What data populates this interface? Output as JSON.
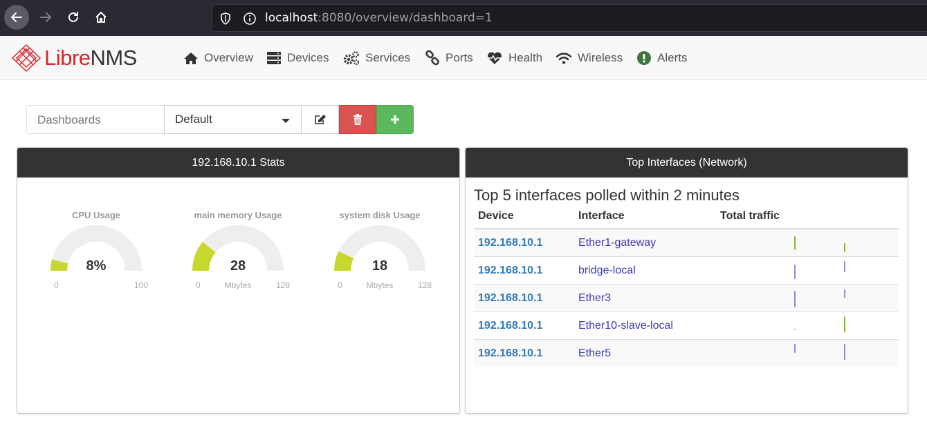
{
  "browser": {
    "url_host": "localhost",
    "url_rest": ":8080/overview/dashboard=1"
  },
  "brand": {
    "name_part1": "Libre",
    "name_part2": "NMS",
    "accent_color": "#d9262c"
  },
  "menu": [
    {
      "label": "Overview",
      "icon": "home-icon"
    },
    {
      "label": "Devices",
      "icon": "server-icon"
    },
    {
      "label": "Services",
      "icon": "cogs-icon"
    },
    {
      "label": "Ports",
      "icon": "link-icon"
    },
    {
      "label": "Health",
      "icon": "heartbeat-icon"
    },
    {
      "label": "Wireless",
      "icon": "wifi-icon"
    },
    {
      "label": "Alerts",
      "icon": "exclamation-circle-icon"
    }
  ],
  "dashboard": {
    "label": "Dashboards",
    "selected": "Default"
  },
  "stats_widget": {
    "title": "192.168.10.1 Stats",
    "gauges": [
      {
        "title": "CPU Usage",
        "value": 8,
        "display": "8%",
        "unit": "",
        "min": "0",
        "max": "100"
      },
      {
        "title": "main memory Usage",
        "value": 28,
        "display": "28",
        "unit": "Mbytes",
        "min": "0",
        "max": "128"
      },
      {
        "title": "system disk Usage",
        "value": 18,
        "display": "18",
        "unit": "Mbytes",
        "min": "0",
        "max": "128"
      }
    ],
    "gauge_fill_color": "#c8d72d",
    "gauge_track_color": "#eeeeee"
  },
  "interfaces_widget": {
    "title": "Top Interfaces (Network)",
    "subtitle": "Top 5 interfaces polled within 2 minutes",
    "columns": [
      "Device",
      "Interface",
      "Total traffic"
    ],
    "rows": [
      {
        "device": "192.168.10.1",
        "interface": "Ether1-gateway"
      },
      {
        "device": "192.168.10.1",
        "interface": "bridge-local"
      },
      {
        "device": "192.168.10.1",
        "interface": "Ether3"
      },
      {
        "device": "192.168.10.1",
        "interface": "Ether10-slave-local"
      },
      {
        "device": "192.168.10.1",
        "interface": "Ether5"
      }
    ]
  }
}
